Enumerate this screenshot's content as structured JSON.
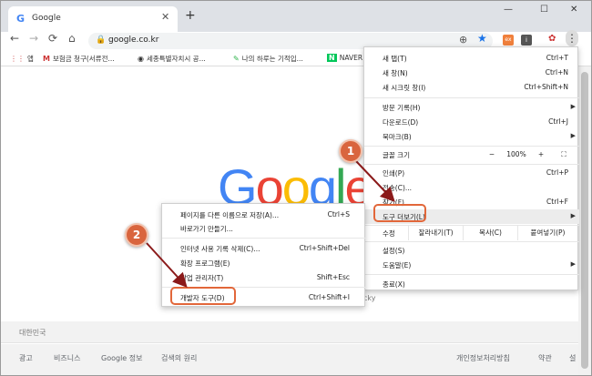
{
  "tab": {
    "favicon": "G",
    "title": "Google",
    "close": "✕",
    "new_tab": "+"
  },
  "window": {
    "minimize": "—",
    "maximize": "☐",
    "close": "✕"
  },
  "nav": {
    "back": "←",
    "forward": "→",
    "reload": "⟳",
    "home": "⌂"
  },
  "address": {
    "lock": "🔒",
    "url": "google.co.kr",
    "star": "★"
  },
  "extensions": {
    "ext1": "ex",
    "ext2": "i",
    "menu": "⋮"
  },
  "bookmarks": [
    {
      "icon": "⋮⋮",
      "label": "앱"
    },
    {
      "icon": "M",
      "label": "보험금 청구(서류전..."
    },
    {
      "icon": "◉",
      "label": "세종특별자치시 공..."
    },
    {
      "icon": "✎",
      "label": "나의 하루는 기적입..."
    },
    {
      "icon": "N",
      "label": "NAVER"
    }
  ],
  "page": {
    "logo": [
      "G",
      "o",
      "o",
      "g",
      "l",
      "e"
    ],
    "lucky": "cky",
    "country": "대한민국",
    "footer_links": [
      "광고",
      "비즈니스",
      "Google 정보",
      "검색의 원리",
      "개인정보처리방침",
      "약관",
      "설"
    ]
  },
  "menu": {
    "new_tab": {
      "label": "새 탭(T)",
      "short": "Ctrl+T"
    },
    "new_window": {
      "label": "새 창(N)",
      "short": "Ctrl+N"
    },
    "incognito": {
      "label": "새 시크릿 창(I)",
      "short": "Ctrl+Shift+N"
    },
    "history": {
      "label": "방문 기록(H)"
    },
    "downloads": {
      "label": "다운로드(D)",
      "short": "Ctrl+J"
    },
    "bookmarks": {
      "label": "북마크(B)"
    },
    "zoom": {
      "label": "글꼴 크기",
      "minus": "−",
      "value": "100%",
      "plus": "+",
      "fullscreen": "⛶"
    },
    "print": {
      "label": "인쇄(P)",
      "short": "Ctrl+P"
    },
    "cast": {
      "label": "전송(C)..."
    },
    "find": {
      "label": "찾기(F)...",
      "short": "Ctrl+F"
    },
    "more_tools": {
      "label": "도구 더보기(L)",
      "arrow": "▶"
    },
    "edit": {
      "label": "수정",
      "cut": "잘라내기(T)",
      "copy": "복사(C)",
      "paste": "붙여넣기(P)"
    },
    "settings": {
      "label": "설정(S)"
    },
    "help": {
      "label": "도움말(E)"
    },
    "exit": {
      "label": "종료(X)"
    }
  },
  "submenu": {
    "save_page": {
      "label": "페이지를 다른 이름으로 저장(A)...",
      "short": "Ctrl+S"
    },
    "shortcut": {
      "label": "바로가기 만들기..."
    },
    "clear_data": {
      "label": "인터넷 사용 기록 삭제(C)...",
      "short": "Ctrl+Shift+Del"
    },
    "extensions": {
      "label": "확장 프로그램(E)"
    },
    "task_manager": {
      "label": "작업 관리자(T)",
      "short": "Shift+Esc"
    },
    "devtools": {
      "label": "개발자 도구(D)",
      "short": "Ctrl+Shift+I"
    }
  },
  "annotations": {
    "badge1": "1",
    "badge2": "2",
    "color": "#d9653e",
    "arrow_color": "#8b1a1a"
  }
}
